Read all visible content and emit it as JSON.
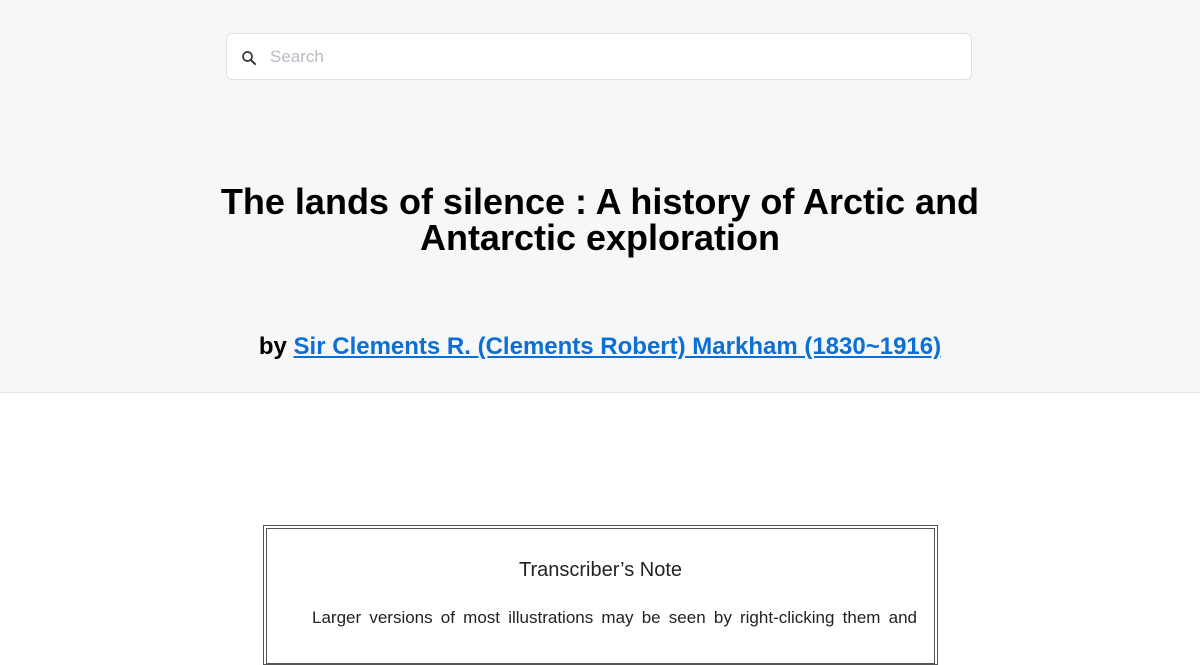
{
  "search": {
    "placeholder": "Search",
    "value": ""
  },
  "book": {
    "title": "The lands of silence : A history of Arctic and Antarctic exploration",
    "by_label": "by",
    "author": "Sir Clements R. (Clements Robert) Markham (1830~1916)"
  },
  "note": {
    "title": "Transcriber’s Note",
    "text": "Larger versions of most illustrations may be seen by right-clicking them and"
  },
  "colors": {
    "header_bg": "#f6f7f9",
    "link": "#0b6fd6",
    "placeholder": "#b8bcc3"
  },
  "icons": {
    "search": "search-icon"
  }
}
